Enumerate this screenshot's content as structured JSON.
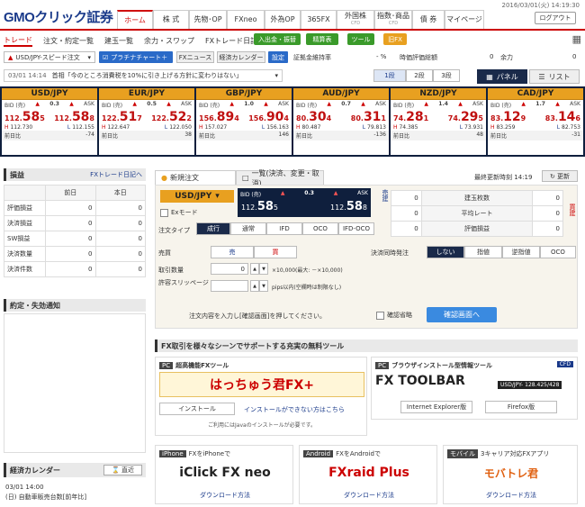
{
  "header": {
    "logo": "GMOクリック証券",
    "timestamp": "2016/03/01(火) 14:19:30",
    "logout": "ログアウト",
    "tabs": [
      {
        "label": "ホーム",
        "sub": ""
      },
      {
        "label": "株 式",
        "sub": ""
      },
      {
        "label": "先物･OP",
        "sub": ""
      },
      {
        "label": "FXneo",
        "sub": ""
      },
      {
        "label": "外為OP",
        "sub": ""
      },
      {
        "label": "365FX",
        "sub": ""
      },
      {
        "label": "外国株",
        "sub": "CFD"
      },
      {
        "label": "指数･商品",
        "sub": "CFD"
      },
      {
        "label": "債 券",
        "sub": ""
      },
      {
        "label": "マイページ",
        "sub": ""
      }
    ]
  },
  "subnav": {
    "links": [
      "トレード",
      "注文・約定一覧",
      "建玉一覧",
      "余力・スワップ",
      "FXトレード日記"
    ],
    "buttons": [
      "入出金・振替",
      "精算表",
      "ツール",
      "旧FX"
    ]
  },
  "toolbar": {
    "order_type": "USD/JPY-スピード注文",
    "chart": "プラチナチャート＋",
    "news": "FXニュース",
    "calendar": "経済カレンダー",
    "settings": "設定",
    "margin_label": "証拠金維持率",
    "margin_value": "- %",
    "eval_label": "時価評価総額",
    "eval_value": "0",
    "yoryoku_label": "余力",
    "yoryoku_value": "0"
  },
  "news": {
    "time": "03/01 14:14",
    "text": "首相「今のところ消費税を10%に引き上げる方針に変わりはない」"
  },
  "seg": [
    "1段",
    "2段",
    "3段"
  ],
  "views": {
    "panel": "パネル",
    "list": "リスト"
  },
  "rates": [
    {
      "pair": "USD/JPY",
      "spread": "0.3",
      "bid_pre": "112.",
      "bid_main": "58",
      "bid_last": "5",
      "ask_pre": "112.",
      "ask_main": "58",
      "ask_last": "8",
      "high": "112.730",
      "low": "112.155",
      "prev": "-74"
    },
    {
      "pair": "EUR/JPY",
      "spread": "0.5",
      "bid_pre": "122.",
      "bid_main": "51",
      "bid_last": "7",
      "ask_pre": "122.",
      "ask_main": "52",
      "ask_last": "2",
      "high": "122.647",
      "low": "122.050",
      "prev": "38"
    },
    {
      "pair": "GBP/JPY",
      "spread": "1.0",
      "bid_pre": "156.",
      "bid_main": "89",
      "bid_last": "4",
      "ask_pre": "156.",
      "ask_main": "90",
      "ask_last": "4",
      "high": "157.027",
      "low": "156.163",
      "prev": "146"
    },
    {
      "pair": "AUD/JPY",
      "spread": "0.7",
      "bid_pre": "80.",
      "bid_main": "30",
      "bid_last": "4",
      "ask_pre": "80.",
      "ask_main": "31",
      "ask_last": "1",
      "high": "80.487",
      "low": "79.813",
      "prev": "-136"
    },
    {
      "pair": "NZD/JPY",
      "spread": "1.4",
      "bid_pre": "74.",
      "bid_main": "28",
      "bid_last": "1",
      "ask_pre": "74.",
      "ask_main": "29",
      "ask_last": "5",
      "high": "74.385",
      "low": "73.931",
      "prev": "48"
    },
    {
      "pair": "CAD/JPY",
      "spread": "1.7",
      "bid_pre": "83.",
      "bid_main": "12",
      "bid_last": "9",
      "ask_pre": "83.",
      "ask_main": "14",
      "ask_last": "6",
      "high": "83.259",
      "low": "82.753",
      "prev": "-31"
    }
  ],
  "rate_labels": {
    "bid": "BID (売)",
    "ask": "ASK",
    "high": "H",
    "low": "L",
    "prev": "前日比"
  },
  "pl": {
    "title": "損益",
    "diary": "FXトレード日記へ",
    "cols": [
      "前日",
      "本日"
    ],
    "rows": [
      {
        "label": "評価損益",
        "prev": "0",
        "today": "0"
      },
      {
        "label": "決済損益",
        "prev": "0",
        "today": "0"
      },
      {
        "label": "SW損益",
        "prev": "0",
        "today": "0"
      },
      {
        "label": "決済数量",
        "prev": "0",
        "today": "0"
      },
      {
        "label": "決済件数",
        "prev": "0",
        "today": "0"
      }
    ]
  },
  "notice": {
    "title": "約定・失効通知"
  },
  "calendar": {
    "title": "経済カレンダー",
    "button": "直近",
    "time": "03/01 14:00",
    "text": "(日) 自動車販売台数[前年比]"
  },
  "order": {
    "tab_new": "新規注文",
    "tab_list": "一覧(決済、変更・取消)",
    "update_label": "最終更新時刻",
    "update_time": "14:19",
    "refresh": "更新",
    "pair": "USD/JPY",
    "exmode": "Exモード",
    "bid": "BID (売)",
    "ask": "ASK",
    "spread": "0.3",
    "bid_pre": "112.",
    "bid_main": "58",
    "bid_last": "5",
    "ask_pre": "112.",
    "ask_main": "58",
    "ask_last": "8",
    "type_label": "注文タイプ",
    "types": [
      "成行",
      "通常",
      "IFD",
      "OCO",
      "IFD-OCO"
    ],
    "side_label": "売買",
    "sell": "売",
    "buy": "買",
    "qty_label": "取引数量",
    "qty": "0",
    "qty_unit": "×10,000(最大: －×10,000)",
    "slip_label": "許容スリッページ",
    "slip_unit": "pips以内(空欄時は制限なし)",
    "settle_label": "決済同時発注",
    "settle_opts": [
      "しない",
      "指値",
      "逆指値",
      "OCO"
    ],
    "instruct": "注文内容を入力し[確認画面]を押してください。",
    "skip": "確認省略",
    "confirm": "確認画面へ"
  },
  "summary": {
    "sell": "売建",
    "buy": "買建",
    "rows": [
      {
        "left": "0",
        "label": "建玉枚数",
        "right": "0"
      },
      {
        "left": "0",
        "label": "平均レート",
        "right": "0"
      },
      {
        "left": "0",
        "label": "評価損益",
        "right": "0"
      }
    ]
  },
  "tools": {
    "title": "FX取引を様々なシーンでサポートする充実の無料ツール",
    "hatchu_tag": "PC",
    "hatchu_title": "超高機能FXツール",
    "hatchu_name": "はっちゅう君FX+",
    "hatchu_install": "インストール",
    "hatchu_cant": "インストールができない方はこちら",
    "hatchu_note": "ご利用にはJavaのインストールが必要です。",
    "toolbar_tag": "PC",
    "toolbar_title": "ブラウザインストール型情報ツール",
    "toolbar_name": "FX TOOLBAR",
    "ie": "Internet Explorer版",
    "ff": "Firefox版",
    "toolbar_pair": "USD/JPY-",
    "toolbar_rate": "128.425/428",
    "cfd": "CFD",
    "iphone_tag": "iPhone",
    "iphone_title": "FXをiPhoneで",
    "iphone_name": "iClick FX neo",
    "android_tag": "Android",
    "android_title": "FXをAndroidで",
    "android_name": "FXraid Plus",
    "mobile_tag": "モバイル",
    "mobile_title": "3キャリア対応FXアプリ",
    "mobile_name": "モバトレ君",
    "download": "ダウンロード方法"
  }
}
